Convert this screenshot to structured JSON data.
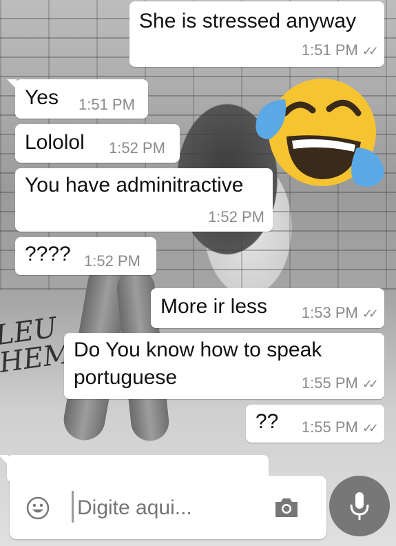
{
  "messages": [
    {
      "text": "She is stressed anyway",
      "time": "1:51 PM",
      "direction": "out"
    },
    {
      "text": "Yes",
      "time": "1:51 PM",
      "direction": "in"
    },
    {
      "text": "Lololol",
      "time": "1:52 PM",
      "direction": "in"
    },
    {
      "text": "You have adminitractive",
      "time": "1:52 PM",
      "direction": "in"
    },
    {
      "text": "????",
      "time": "1:52 PM",
      "direction": "in"
    },
    {
      "text": "More ir less",
      "time": "1:53 PM",
      "direction": "out"
    },
    {
      "text": "Do You know how to speak portuguese",
      "line1": "Do You know how to speak",
      "line2": "portuguese",
      "time": "1:55 PM",
      "direction": "out"
    },
    {
      "text": "??",
      "time": "1:55 PM",
      "direction": "out"
    }
  ],
  "input": {
    "placeholder": "Digite aqui..."
  },
  "background": {
    "graffiti": "LEU\nHEM"
  },
  "icons": {
    "emoji": "smiley-icon",
    "camera": "camera-icon",
    "mic": "microphone-icon",
    "read_receipt": "double-check-icon",
    "sticker": "face-with-tears-of-joy-icon"
  },
  "colors": {
    "bubble": "#ffffff",
    "timestamp": "#8a8a8a",
    "mic_button": "#777777",
    "emoji_face": "#f6c431",
    "emoji_tears": "#5aa9e6"
  }
}
